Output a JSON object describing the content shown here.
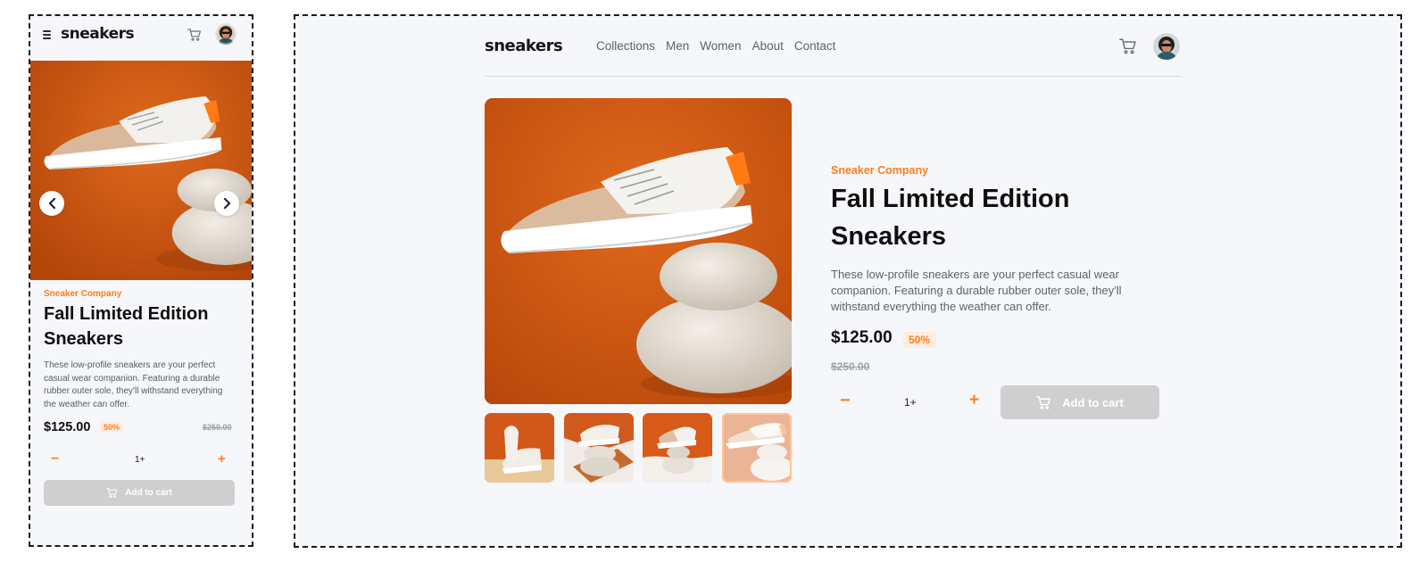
{
  "brand": {
    "logo": "sneakers"
  },
  "nav": {
    "items": [
      "Collections",
      "Men",
      "Women",
      "About",
      "Contact"
    ]
  },
  "product": {
    "company": "Sneaker Company",
    "title": "Fall Limited Edition Sneakers",
    "description": "These low-profile sneakers are your perfect casual wear companion. Featuring a durable rubber outer sole, they'll withstand everything the weather can offer.",
    "price": "$125.00",
    "discount": "50%",
    "original_price": "$250.00",
    "quantity": "1+",
    "add_to_cart": "Add to cart",
    "selected_thumbnail": 4,
    "thumbnail_count": 4
  },
  "colors": {
    "accent": "#ff7d1a",
    "accent_pale": "#ffede0",
    "button_disabled": "#cfcfcf",
    "frame_bg": "#f6f7fb",
    "text_dark": "#0e0e0e",
    "text_muted": "#5d636d"
  },
  "icons": {
    "menu": "hamburger-icon",
    "cart": "cart-icon",
    "prev": "chevron-left-icon",
    "next": "chevron-right-icon",
    "minus": "minus-icon",
    "plus": "plus-icon"
  }
}
